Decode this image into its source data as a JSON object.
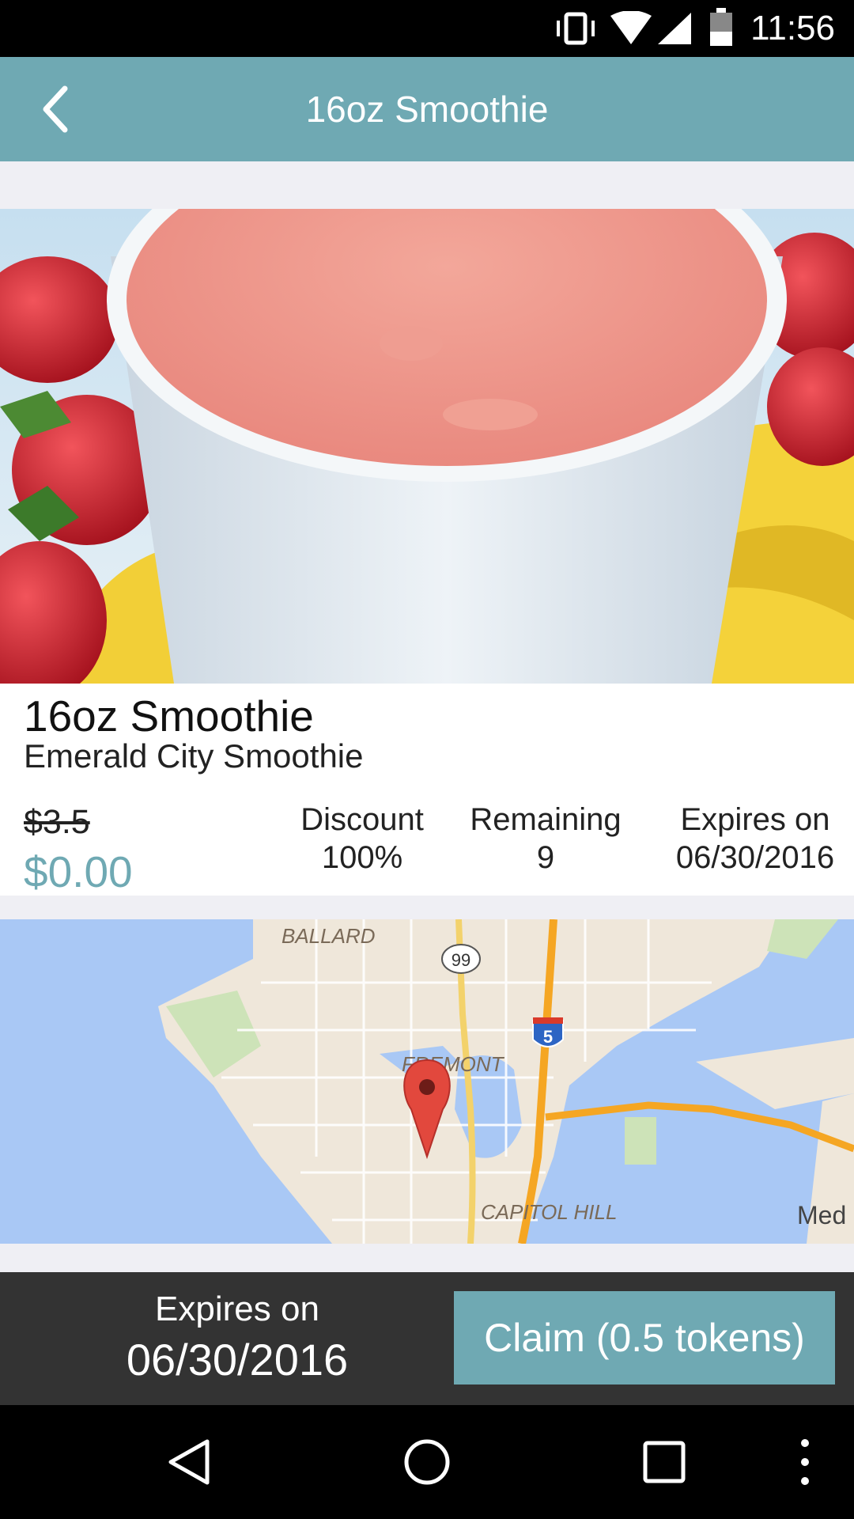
{
  "status_bar": {
    "time": "11:56",
    "icons": [
      "vibrate-icon",
      "wifi-icon",
      "signal-icon",
      "battery-icon"
    ]
  },
  "app_bar": {
    "title": "16oz Smoothie",
    "back_icon": "chevron-left-icon"
  },
  "deal": {
    "title": "16oz Smoothie",
    "merchant": "Emerald City Smoothie",
    "original_price": "$3.5",
    "price": "$0.00",
    "stats": [
      {
        "label": "Discount",
        "value": "100%"
      },
      {
        "label": "Remaining",
        "value": "9"
      },
      {
        "label": "Expires on",
        "value": "06/30/2016"
      }
    ]
  },
  "map": {
    "labels": {
      "ballard": "BALLARD",
      "fremont": "FREMONT",
      "capitol_hill": "CAPITOL HILL",
      "med": "Med",
      "route_99": "99",
      "route_5": "5"
    }
  },
  "action_bar": {
    "expires_label": "Expires on",
    "expires_date": "06/30/2016",
    "claim_label": "Claim (0.5 tokens)"
  },
  "nav_bar": {
    "icons": [
      "back-triangle-icon",
      "home-circle-icon",
      "recents-square-icon",
      "overflow-dots-icon"
    ]
  },
  "colors": {
    "accent": "#6fa9b3",
    "status_bar": "#000000",
    "action_bar": "#333333"
  }
}
